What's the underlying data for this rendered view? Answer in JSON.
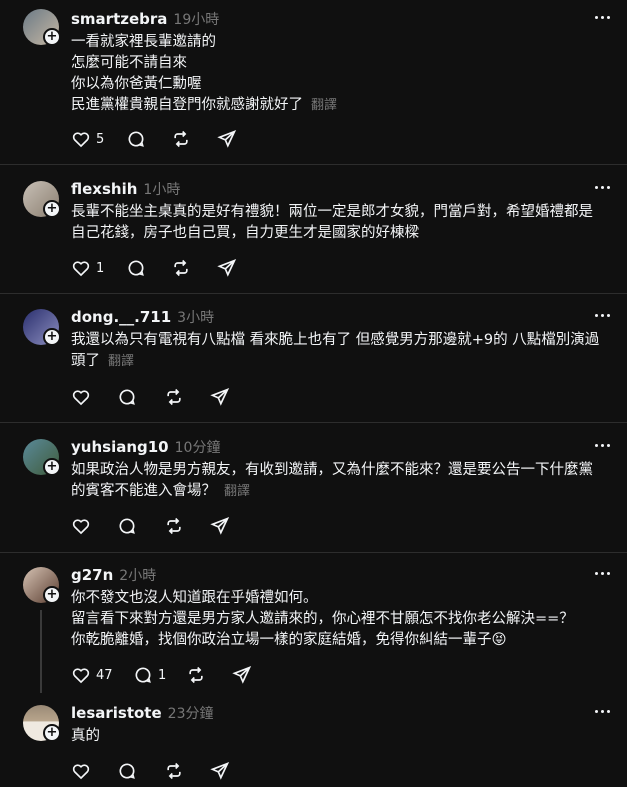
{
  "posts": [
    {
      "username": "smartzebra",
      "time": "19小時",
      "lines": [
        "一看就家裡長輩邀請的",
        "怎麼可能不請自來",
        "你以為你爸黃仁勳喔",
        "民進黨權貴親自登門你就感謝就好了"
      ],
      "translate": "翻譯",
      "likes": "5",
      "replies": "",
      "avatar_colors": [
        "#6b7a86",
        "#c7b8a4"
      ]
    },
    {
      "username": "flexshih",
      "time": "1小時",
      "lines": [
        "長輩不能坐主桌真的是好有禮貌！兩位一定是郎才女貌，門當戶對，希望婚禮都是",
        "自己花錢，房子也自己買，自力更生才是國家的好棟樑"
      ],
      "translate": "",
      "likes": "1",
      "replies": "",
      "avatar_colors": [
        "#c8c0b6",
        "#8a7e70"
      ]
    },
    {
      "username": "dong.__.711",
      "time": "3小時",
      "lines": [
        "我還以為只有電視有八點檔 看來脆上也有了 但感覺男方那邊就+9的 八點檔別演過",
        "頭了"
      ],
      "translate": "翻譯",
      "likes": "",
      "replies": "",
      "avatar_colors": [
        "#2a2f6e",
        "#8d8fbf"
      ]
    },
    {
      "username": "yuhsiang10",
      "time": "10分鐘",
      "lines": [
        "如果政治人物是男方親友，有收到邀請，又為什麼不能來？還是要公告一下什麼黨",
        "的賓客不能進入會場？"
      ],
      "translate": "翻譯",
      "likes": "",
      "replies": "",
      "avatar_colors": [
        "#5a8a9a",
        "#3f5b3a"
      ]
    },
    {
      "username": "g27n",
      "time": "2小時",
      "lines": [
        "你不發文也沒人知道跟在乎婚禮如何。",
        "留言看下來對方還是男方家人邀請來的，你心裡不甘願怎不找你老公解決==？",
        "你乾脆離婚，找個你政治立場一樣的家庭結婚，免得你糾結一輩子😝"
      ],
      "translate": "",
      "likes": "47",
      "replies": "1",
      "avatar_colors": [
        "#d6c3b4",
        "#5a3d30"
      ]
    },
    {
      "username": "lesaristote",
      "time": "23分鐘",
      "lines": [
        "真的"
      ],
      "translate": "",
      "likes": "",
      "replies": "",
      "avatar_colors": [
        "#9a8a76",
        "#efe9e0"
      ]
    }
  ],
  "colors": {
    "background": "#101010",
    "text": "#f3f5f7",
    "muted": "#777777",
    "divider": "#2d2d2d"
  },
  "icons": [
    "heart-icon",
    "reply-icon",
    "repost-icon",
    "share-icon",
    "more-icon",
    "follow-plus-icon"
  ]
}
